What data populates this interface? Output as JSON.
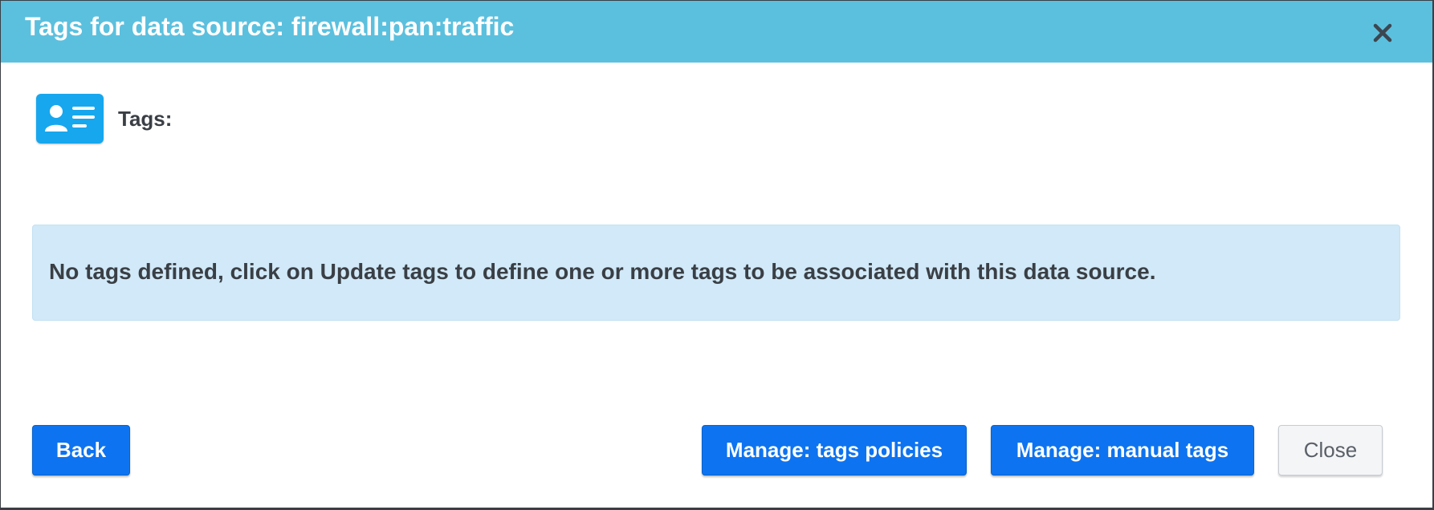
{
  "dialog": {
    "title": "Tags for data source: firewall:pan:traffic",
    "close_icon": "close-icon",
    "header_color": "#5bc0de"
  },
  "tags": {
    "label": "Tags:",
    "icon": "id-card-icon",
    "icon_color": "#17a7ee"
  },
  "info": {
    "message": "No tags defined, click on Update tags to define one or more tags to be associated with this data source.",
    "background": "#d1e9f8"
  },
  "footer": {
    "back_label": "Back",
    "policies_label": "Manage: tags policies",
    "manual_label": "Manage: manual tags",
    "close_label": "Close",
    "primary_color": "#0d73f0"
  }
}
